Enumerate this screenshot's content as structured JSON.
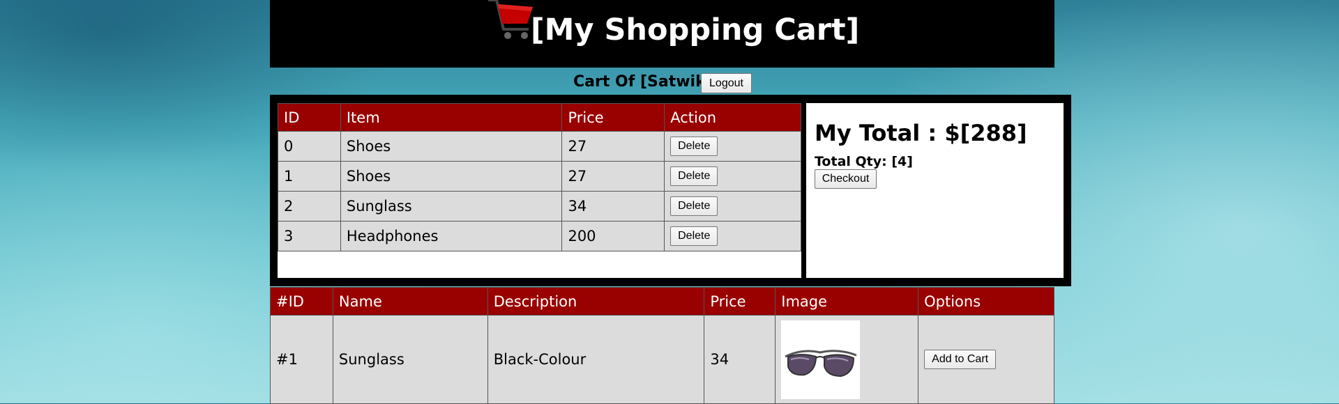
{
  "header": {
    "title": "[My Shopping Cart]",
    "cart_icon": "shopping-cart-icon",
    "accent": "#cc0000"
  },
  "user": {
    "label": "Cart Of [Satwik]",
    "logout_label": "Logout"
  },
  "cart": {
    "columns": [
      "ID",
      "Item",
      "Price",
      "Action"
    ],
    "rows": [
      {
        "id": "0",
        "item": "Shoes",
        "price": "27",
        "action": "Delete"
      },
      {
        "id": "1",
        "item": "Shoes",
        "price": "27",
        "action": "Delete"
      },
      {
        "id": "2",
        "item": "Sunglass",
        "price": "34",
        "action": "Delete"
      },
      {
        "id": "3",
        "item": "Headphones",
        "price": "200",
        "action": "Delete"
      }
    ]
  },
  "summary": {
    "total": "My Total : $[288]",
    "qty": "Total Qty: [4]",
    "checkout_label": "Checkout"
  },
  "products": {
    "columns": [
      "#ID",
      "Name",
      "Description",
      "Price",
      "Image",
      "Options"
    ],
    "rows": [
      {
        "id": "#1",
        "name": "Sunglass",
        "description": "Black-Colour",
        "price": "34",
        "image": "sunglasses-image",
        "option": "Add to Cart"
      }
    ]
  },
  "colors": {
    "table_header": "#990000",
    "row_bg": "#dcdcdc"
  }
}
